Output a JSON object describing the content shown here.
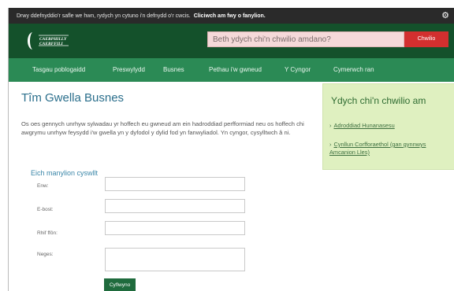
{
  "cookie_bar": {
    "text": "Drwy ddefnyddio'r safle we hwn, rydych yn cytuno i'n defnydd o'r cwcis.",
    "link": "Cliciwch am fwy o fanylion."
  },
  "header": {
    "logo_text": "CAERPHILLY CAERFFILI",
    "search": {
      "placeholder": "Beth ydych chi'n chwilio amdano?",
      "button": "Chwilio"
    }
  },
  "nav": {
    "items": [
      "Tasgau poblogaidd",
      "Preswylydd",
      "Busnes",
      "Pethau i'w gwneud",
      "Y Cyngor",
      "Cymerwch ran"
    ]
  },
  "main": {
    "title": "Tîm Gwella Busnes",
    "intro": "Os oes gennych unrhyw sylwadau yr hoffech eu gwneud am ein hadroddiad perfformiad neu os hoffech chi awgrymu unrhyw feysydd i'w gwella yn y dyfodol y dylid fod yn fanwyliadol. Yn cyngor, cysylltwch â ni."
  },
  "sidebar": {
    "title": "Ydych chi'n chwilio am",
    "links": [
      "Adroddiad Hunanasesu",
      "Cynllun Corfforaethol (gan gynnwys Amcanion Lles)"
    ]
  },
  "form": {
    "heading": "Eich manylion cyswllt",
    "fields": [
      {
        "label": "Enw:"
      },
      {
        "label": "E-bost:"
      },
      {
        "label": "Rhif ffôn:"
      },
      {
        "label": "Neges:"
      }
    ],
    "submit": "Cyflwyno"
  },
  "colors": {
    "header": "#14512b",
    "nav": "#2b8a55",
    "search_button": "#d32f2f",
    "sidebar_bg": "#dff0c0",
    "title": "#2b6f8c"
  }
}
